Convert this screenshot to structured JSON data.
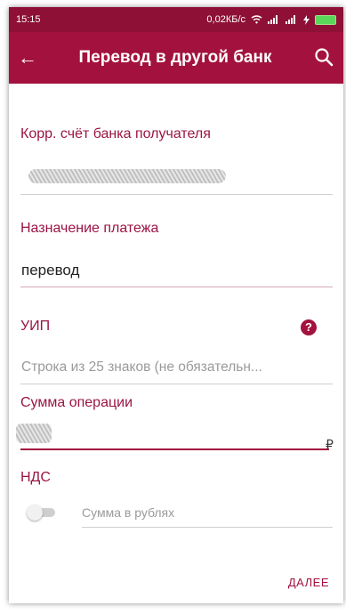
{
  "status_bar": {
    "time": "15:15",
    "network_speed": "0,02КБ/с",
    "icons": [
      "wifi-icon",
      "signal-icon",
      "signal-icon",
      "charging-icon",
      "battery-icon"
    ]
  },
  "app_bar": {
    "back_icon": "←",
    "title": "Перевод в другой банк",
    "search_icon": "search-icon"
  },
  "form": {
    "corr_account": {
      "label": "Корр. счёт банка получателя"
    },
    "purpose": {
      "label": "Назначение платежа",
      "value": "перевод"
    },
    "uip": {
      "label": "УИП",
      "help_icon": "?",
      "placeholder": "Строка из 25 знаков (не обязательн..."
    },
    "amount": {
      "label": "Сумма операции",
      "currency": "₽"
    },
    "vat": {
      "label": "НДС",
      "placeholder": "Сумма в рублях"
    }
  },
  "actions": {
    "next_label": "ДАЛЕЕ"
  },
  "colors": {
    "primary": "#a3123e",
    "status_bar": "#8e1037",
    "label": "#9b1444"
  }
}
